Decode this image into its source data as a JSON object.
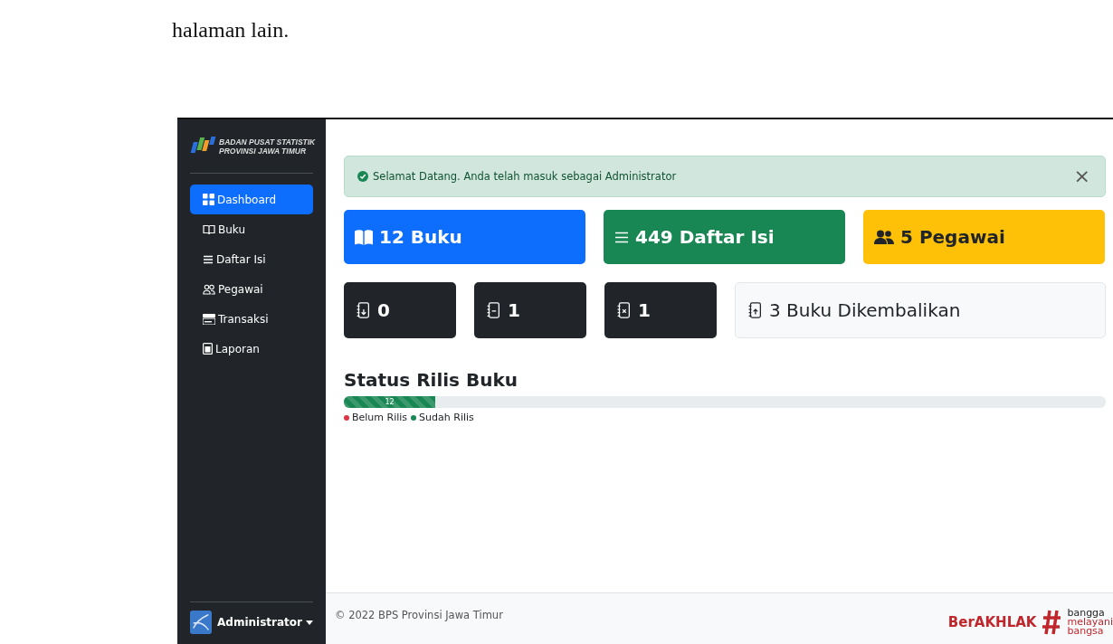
{
  "intro_text": "halaman lain.",
  "sidebar": {
    "brand": [
      "BADAN PUSAT STATISTIK",
      "PROVINSI JAWA TIMUR"
    ],
    "items": [
      {
        "label": "Dashboard",
        "selected": true
      },
      {
        "label": "Buku",
        "selected": false
      },
      {
        "label": "Daftar Isi",
        "selected": false
      },
      {
        "label": "Pegawai",
        "selected": false
      },
      {
        "label": "Transaksi",
        "selected": false
      },
      {
        "label": "Laporan",
        "selected": false
      }
    ],
    "user": "Administrator"
  },
  "alert": {
    "text": "Selamat Datang. Anda telah masuk sebagai Administrator",
    "close": "×"
  },
  "stats": [
    {
      "kind": "primary",
      "text": "12 Buku"
    },
    {
      "kind": "success",
      "text": "449 Daftar Isi"
    },
    {
      "kind": "warning",
      "text": "5 Pegawai"
    }
  ],
  "transactions": [
    {
      "kind": "dark",
      "text": "0"
    },
    {
      "kind": "dark",
      "text": "1"
    },
    {
      "kind": "dark",
      "text": "1"
    },
    {
      "kind": "light",
      "text": "3 Buku Dikembalikan"
    }
  ],
  "release_status": {
    "title": "Status Rilis Buku",
    "bars": [
      {
        "label": "12",
        "level": 0.12,
        "color": "#198754"
      }
    ],
    "legend": [
      {
        "label": "Belum Rilis",
        "color": "#dc3545"
      },
      {
        "label": "Sudah Rilis",
        "color": "#198754"
      }
    ]
  },
  "footer": {
    "copyright": "© 2022 BPS Provinsi Jawa Timur",
    "logo_text": "BerAKHLAK",
    "slogan": [
      "bangga",
      "melayani",
      "bangsa"
    ]
  }
}
